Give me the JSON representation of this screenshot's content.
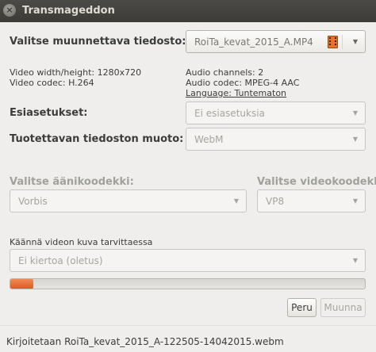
{
  "window": {
    "title": "Transmageddon",
    "close_glyph": "×"
  },
  "source": {
    "label": "Valitse muunnettava tiedosto:",
    "selected_file": "RoiTa_kevat_2015_A.MP4",
    "icon": "film-icon"
  },
  "video_info": {
    "size": "Video width/height: 1280x720",
    "codec": "Video codec: H.264"
  },
  "audio_info": {
    "channels": "Audio channels: 2",
    "codec": "Audio codec: MPEG-4 AAC",
    "language": "Language: Tuntematon"
  },
  "presets": {
    "label": "Esiasetukset:",
    "value": "Ei esiasetuksia"
  },
  "output_format": {
    "label": "Tuotettavan tiedoston muoto:",
    "value": "WebM"
  },
  "audio_codec": {
    "label": "Valitse äänikoodekki:",
    "value": "Vorbis"
  },
  "video_codec": {
    "label": "Valitse videokoodekki:",
    "value": "VP8"
  },
  "rotation": {
    "label": "Käännä videon kuva tarvittaessa",
    "value": "Ei kiertoa (oletus)"
  },
  "progress": {
    "fraction": 0.065
  },
  "buttons": {
    "cancel": "Peru",
    "convert": "Muunna"
  },
  "status": {
    "text": "Kirjoitetaan RoiTa_kevat_2015_A-122505-14042015.webm"
  },
  "dropdown_arrow": "▼",
  "colors": {
    "accent": "#e05a23",
    "titlebar": "#3c3b37"
  }
}
